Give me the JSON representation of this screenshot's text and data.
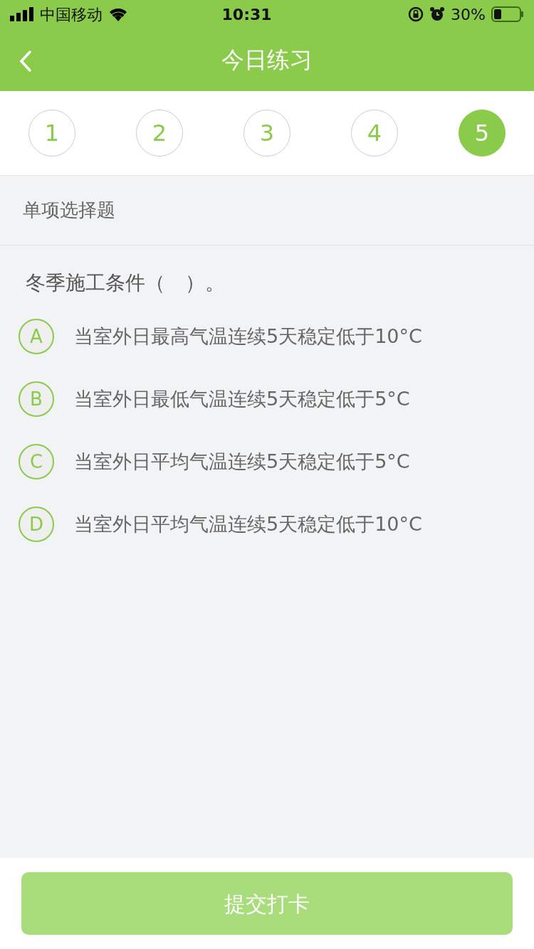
{
  "status_bar": {
    "carrier": "中国移动",
    "time": "10:31",
    "battery": "30%"
  },
  "header": {
    "title": "今日练习"
  },
  "question_nav": [
    {
      "label": "1",
      "selected": false
    },
    {
      "label": "2",
      "selected": false
    },
    {
      "label": "3",
      "selected": false
    },
    {
      "label": "4",
      "selected": false
    },
    {
      "label": "5",
      "selected": true
    }
  ],
  "section": {
    "label": "单项选择题"
  },
  "question": {
    "text": "冬季施工条件（　）。",
    "options": [
      {
        "letter": "A",
        "text": "当室外日最高气温连续5天稳定低于10°C",
        "selected": false
      },
      {
        "letter": "B",
        "text": "当室外日最低气温连续5天稳定低于5°C",
        "selected": false
      },
      {
        "letter": "C",
        "text": "当室外日平均气温连续5天稳定低于5°C",
        "selected": false
      },
      {
        "letter": "D",
        "text": "当室外日平均气温连续5天稳定低于10°C",
        "selected": false
      }
    ]
  },
  "submit": {
    "label": "提交打卡",
    "disabled": true
  }
}
